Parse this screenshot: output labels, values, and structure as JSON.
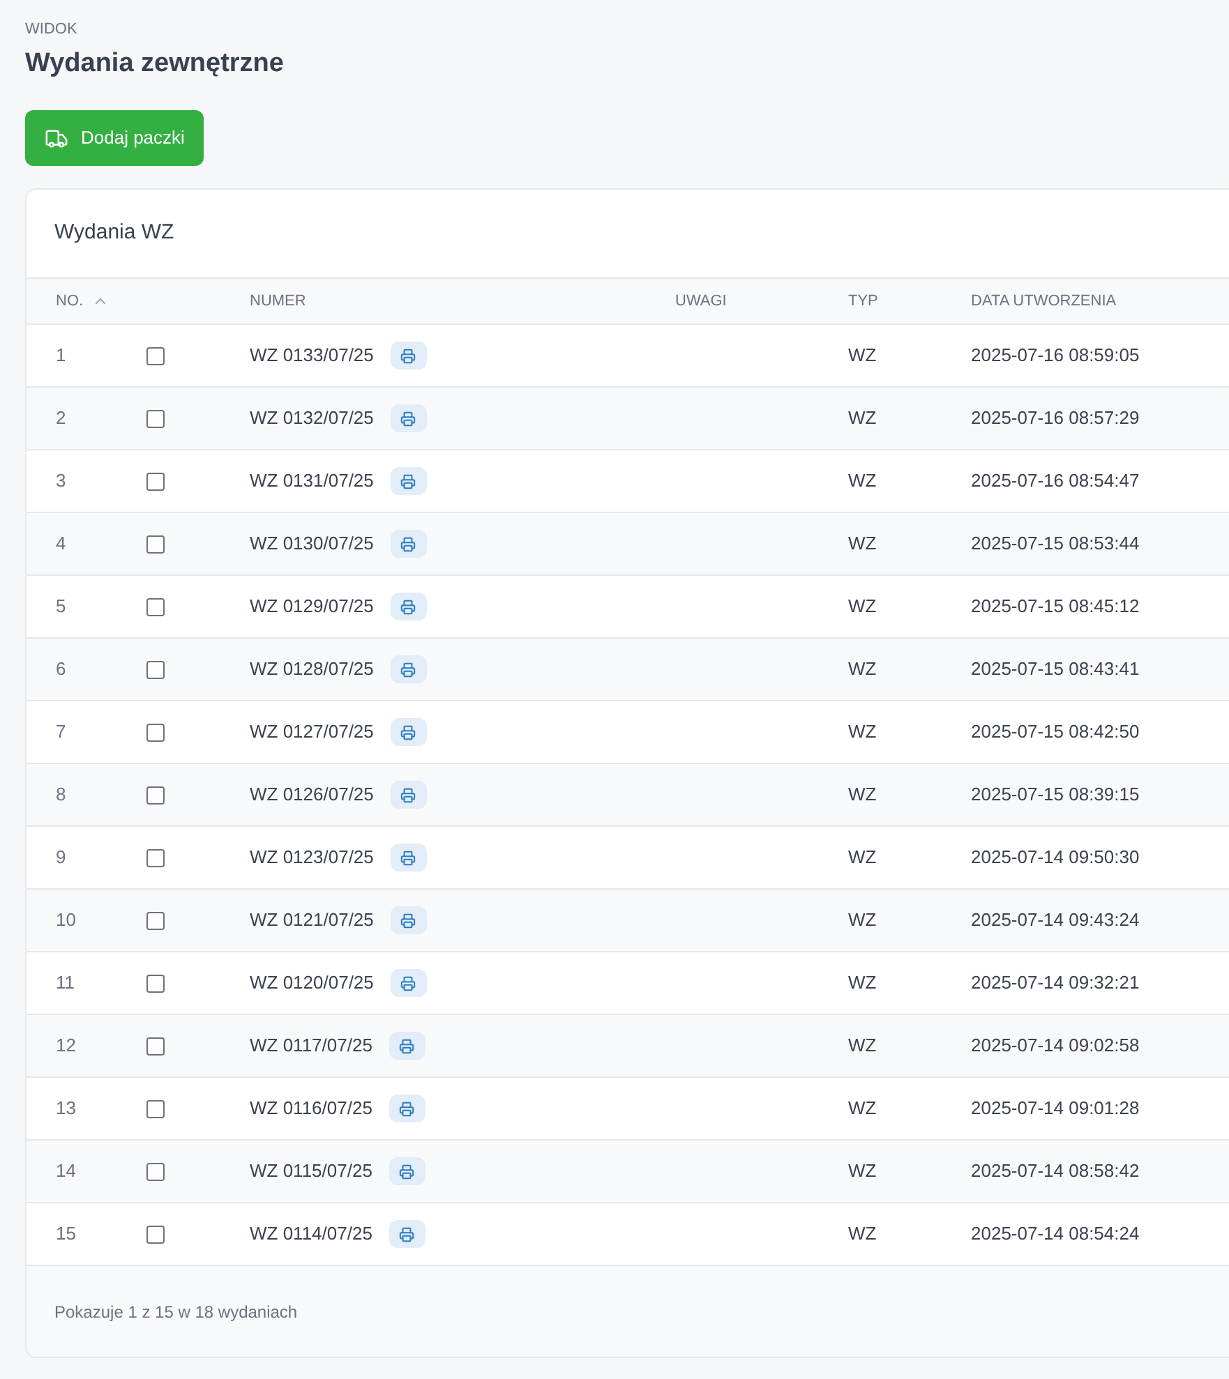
{
  "breadcrumb": "WIDOK",
  "title": "Wydania zewnętrzne",
  "add_button": {
    "label": "Dodaj paczki"
  },
  "card_title": "Wydania WZ",
  "columns": [
    {
      "label": "NO.",
      "sorted": true
    },
    {
      "sorted": false
    },
    {
      "label": "NUMER",
      "sorted": false
    },
    {
      "label": "UWAGI",
      "sorted": false
    },
    {
      "label": "TYP",
      "sorted": false
    },
    {
      "label": "DATA UTWORZENIA",
      "sorted": false
    }
  ],
  "rows": [
    {
      "no": "1",
      "checked": false,
      "number": "WZ 0133/07/25",
      "type": "WZ",
      "created": "2025-07-16 08:59:05"
    },
    {
      "no": "2",
      "checked": false,
      "number": "WZ 0132/07/25",
      "type": "WZ",
      "created": "2025-07-16 08:57:29"
    },
    {
      "no": "3",
      "checked": false,
      "number": "WZ 0131/07/25",
      "type": "WZ",
      "created": "2025-07-16 08:54:47"
    },
    {
      "no": "4",
      "checked": false,
      "number": "WZ 0130/07/25",
      "type": "WZ",
      "created": "2025-07-15 08:53:44"
    },
    {
      "no": "5",
      "checked": false,
      "number": "WZ 0129/07/25",
      "type": "WZ",
      "created": "2025-07-15 08:45:12"
    },
    {
      "no": "6",
      "checked": false,
      "number": "WZ 0128/07/25",
      "type": "WZ",
      "created": "2025-07-15 08:43:41"
    },
    {
      "no": "7",
      "checked": false,
      "number": "WZ 0127/07/25",
      "type": "WZ",
      "created": "2025-07-15 08:42:50"
    },
    {
      "no": "8",
      "checked": false,
      "number": "WZ 0126/07/25",
      "type": "WZ",
      "created": "2025-07-15 08:39:15"
    },
    {
      "no": "9",
      "checked": false,
      "number": "WZ 0123/07/25",
      "type": "WZ",
      "created": "2025-07-14 09:50:30"
    },
    {
      "no": "10",
      "checked": false,
      "number": "WZ 0121/07/25",
      "type": "WZ",
      "created": "2025-07-14 09:43:24"
    },
    {
      "no": "11",
      "checked": false,
      "number": "WZ 0120/07/25",
      "type": "WZ",
      "created": "2025-07-14 09:32:21"
    },
    {
      "no": "12",
      "checked": false,
      "number": "WZ 0117/07/25",
      "type": "WZ",
      "created": "2025-07-14 09:02:58"
    },
    {
      "no": "13",
      "checked": false,
      "number": "WZ 0116/07/25",
      "type": "WZ",
      "created": "2025-07-14 09:01:28"
    },
    {
      "no": "14",
      "checked": false,
      "number": "WZ 0115/07/25",
      "type": "WZ",
      "created": "2025-07-14 08:58:42"
    },
    {
      "no": "15",
      "checked": false,
      "number": "WZ 0114/07/25",
      "type": "WZ",
      "created": "2025-07-14 08:54:24"
    }
  ],
  "footer": "Pokazuje 1 z 15 w 18 wydaniach"
}
